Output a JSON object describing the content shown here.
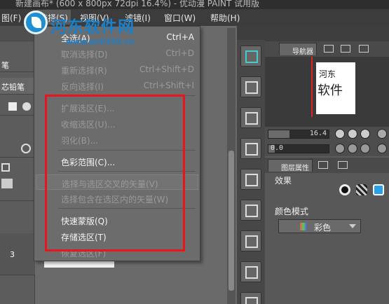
{
  "window": {
    "title": "新建画布* (600 x 800px 72dpi 16.4%) - 优动漫 PAINT 试用版"
  },
  "menubar": {
    "items": [
      {
        "label": "图(F)"
      },
      {
        "label": "选择(S)"
      },
      {
        "label": "视图(V)"
      },
      {
        "label": "滤镜(I)"
      },
      {
        "label": "窗口(W)"
      },
      {
        "label": "帮助(H)"
      }
    ]
  },
  "watermark": {
    "name": "河东软件网",
    "url": "www.pc0359.cn"
  },
  "left_panel": {
    "labels": [
      "笔",
      "芯铅笔",
      "3"
    ]
  },
  "select_menu": {
    "items": [
      {
        "label": "全选(A)",
        "shortcut": "Ctrl+A",
        "enabled": true
      },
      {
        "label": "取消选择(D)",
        "shortcut": "Ctrl+D",
        "enabled": false
      },
      {
        "label": "重新选择(R)",
        "shortcut": "Ctrl+Shift+D",
        "enabled": false
      },
      {
        "label": "反向选择(I)",
        "shortcut": "Ctrl+Shift+I",
        "enabled": false
      },
      {
        "label": "扩展选区(E)...",
        "shortcut": "",
        "enabled": false
      },
      {
        "label": "收缩选区(U)...",
        "shortcut": "",
        "enabled": false
      },
      {
        "label": "羽化(B)...",
        "shortcut": "",
        "enabled": false
      },
      {
        "label": "色彩范围(C)...",
        "shortcut": "",
        "enabled": true
      },
      {
        "label": "选择与选区交叉的矢量(V)",
        "shortcut": "",
        "enabled": false
      },
      {
        "label": "选择包含在选区内的矢量(W)",
        "shortcut": "",
        "enabled": false
      },
      {
        "label": "快速蒙版(Q)",
        "shortcut": "",
        "enabled": true
      },
      {
        "label": "存储选区(T)",
        "shortcut": "",
        "enabled": true
      },
      {
        "label": "恢复选区(F)",
        "shortcut": "",
        "enabled": false
      }
    ]
  },
  "navigator": {
    "tab_label": "导航器",
    "preview_text_1": "河东",
    "preview_text_2": "软件",
    "zoom_value": "16.4",
    "rotation_value": "0.0",
    "zoom_level": 0.35,
    "rotation_level": 0.1
  },
  "layer_properties": {
    "tab_label": "图层属性",
    "effect_label": "效果",
    "color_mode_label": "颜色模式",
    "color_mode_value": "彩色"
  },
  "colors": {
    "highlight_border": "#e8141e",
    "watermark_blue": "#1c7fc8",
    "effect_blue": "#2aa0e8"
  }
}
